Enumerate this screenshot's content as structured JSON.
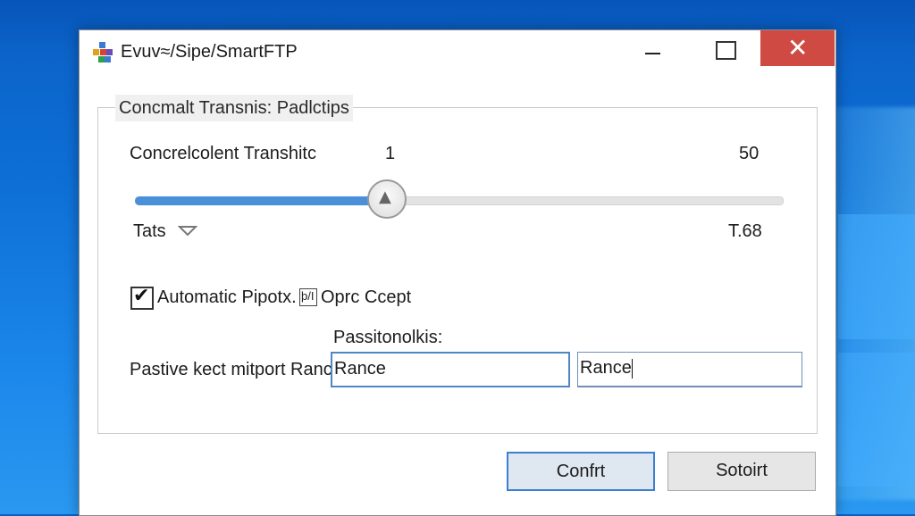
{
  "window": {
    "title": "Evuv≈/Sipe/SmartFTP",
    "controls": {
      "minimize": "minimize",
      "maximize": "maximize",
      "close": "✕"
    }
  },
  "group": {
    "legend": "Concmalt Transnis: Padlctips"
  },
  "transfers": {
    "label": "Concrelcolent Transhitc",
    "min_value": "1",
    "max_value": "50",
    "slider_level": 0.39
  },
  "limits": {
    "left_label": "Tats",
    "right_value": "T.68"
  },
  "options": {
    "checkbox1_label": "Automatic Pipotx.",
    "checkbox1_checked": true,
    "checkbox2_glyph": "þ/I",
    "checkbox2_label": "Oprc Ccept"
  },
  "passive": {
    "header": "Passitonolkis:",
    "label": "Pastive kect mitport Rance:",
    "field1_value": "Rance",
    "field2_value": "Rance"
  },
  "buttons": {
    "confirm": "Confrt",
    "other": "Sotoirt"
  },
  "colors": {
    "accent": "#4a90d9",
    "close_red": "#d04a44",
    "desktop_blue": "#0d6fd6"
  },
  "icons": {
    "app": "smartftp-app-icon",
    "slider_thumb": "up-arrow-icon",
    "dropdown": "chevron-down-icon"
  }
}
